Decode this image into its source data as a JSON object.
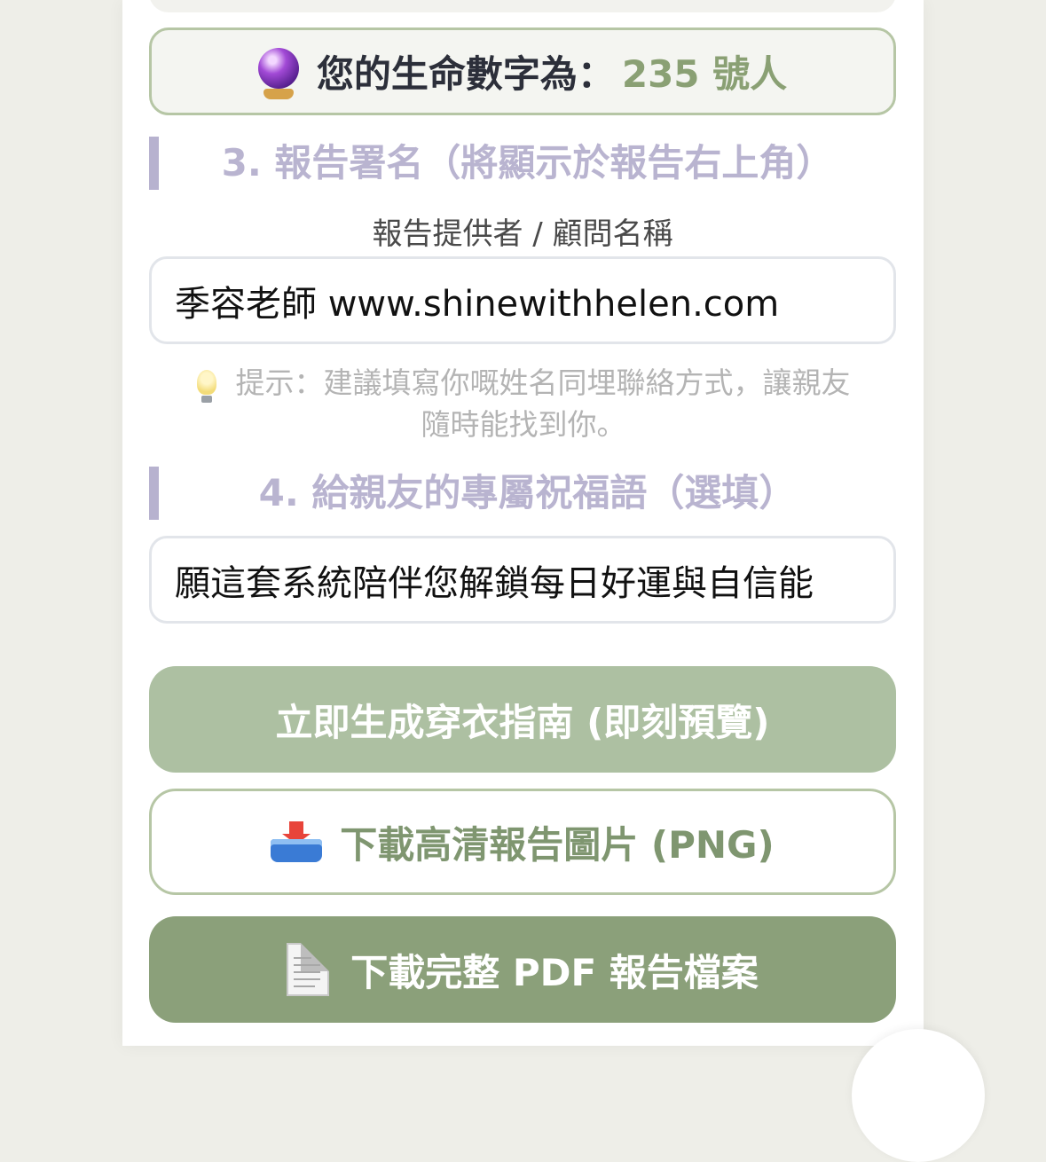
{
  "life_number": {
    "prefix": "您的生命數字為：",
    "value": "235 號人",
    "icon": "crystal-ball-icon"
  },
  "section3": {
    "heading": "3. 報告署名（將顯示於報告右上角）",
    "label": "報告提供者 / 顧問名稱",
    "value": "季容老師 www.shinewithhelen.com",
    "hint_icon": "lightbulb-icon",
    "hint_line1": "提示：建議填寫你嘅姓名同埋聯絡方式，讓親友",
    "hint_line2": "隨時能找到你。"
  },
  "section4": {
    "heading": "4. 給親友的專屬祝福語（選填）",
    "value": "願這套系統陪伴您解鎖每日好運與自信能"
  },
  "buttons": {
    "generate": "立即生成穿衣指南 (即刻預覽)",
    "download_png": "下載高清報告圖片 (PNG)",
    "download_png_icon": "inbox-tray-icon",
    "download_pdf": "下載完整 PDF 報告檔案",
    "download_pdf_icon": "page-document-icon"
  },
  "colors": {
    "accent_green": "#8ba07a",
    "light_green": "#adc0a2",
    "heading_lavender": "#b9b4d0"
  }
}
